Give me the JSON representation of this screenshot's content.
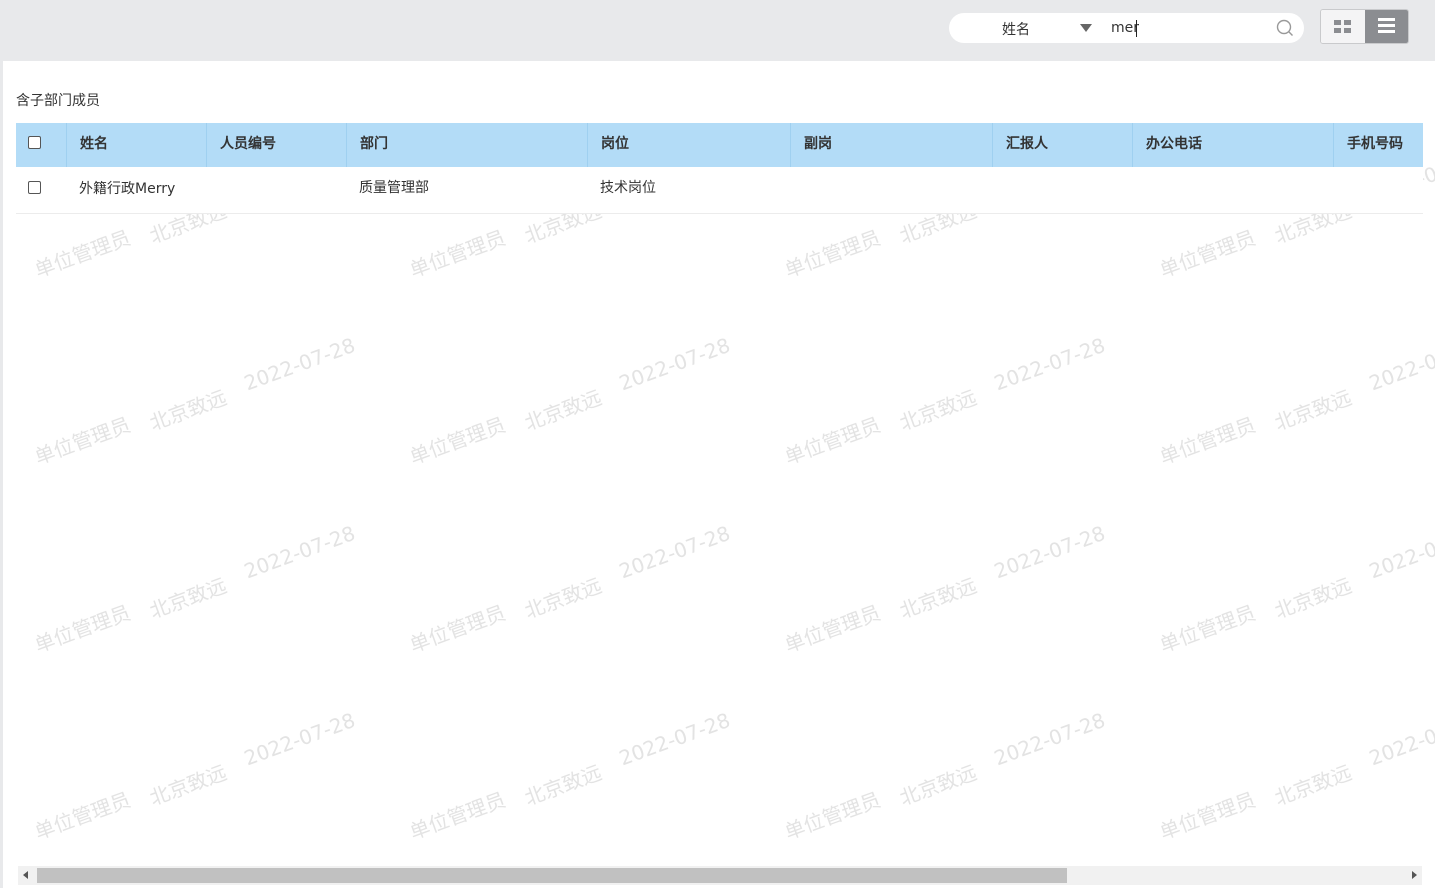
{
  "search": {
    "field_label": "姓名",
    "value": "mer"
  },
  "view_toggle": {
    "active": "list"
  },
  "section_title": "含子部门成员",
  "table": {
    "columns": [
      "姓名",
      "人员编号",
      "部门",
      "岗位",
      "副岗",
      "汇报人",
      "办公电话",
      "手机号码"
    ],
    "rows": [
      {
        "name": "外籍行政Merry",
        "employee_id": "",
        "department": "质量管理部",
        "position": "技术岗位",
        "secondary_position": "",
        "reports_to": "",
        "office_phone": "",
        "mobile": ""
      }
    ]
  },
  "watermark": {
    "role": "单位管理员",
    "company": "北京致远",
    "date": "2022-07-28"
  },
  "colors": {
    "header_bg": "#b3dcf7",
    "page_bg": "#e8e9eb",
    "toggle_active": "#8b8d91"
  }
}
